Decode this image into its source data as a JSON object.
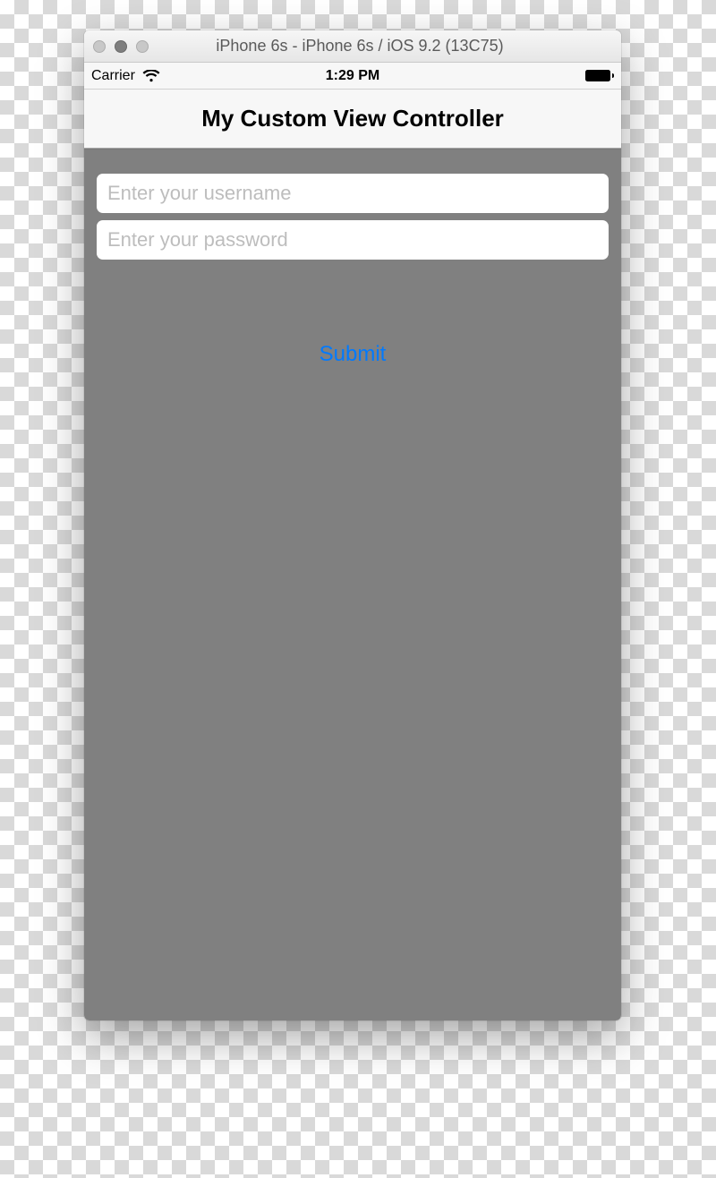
{
  "window": {
    "title": "iPhone 6s - iPhone 6s / iOS 9.2 (13C75)"
  },
  "statusbar": {
    "carrier": "Carrier",
    "time": "1:29 PM"
  },
  "navbar": {
    "title": "My Custom View Controller"
  },
  "form": {
    "username_placeholder": "Enter your username",
    "password_placeholder": "Enter your password",
    "submit_label": "Submit"
  }
}
